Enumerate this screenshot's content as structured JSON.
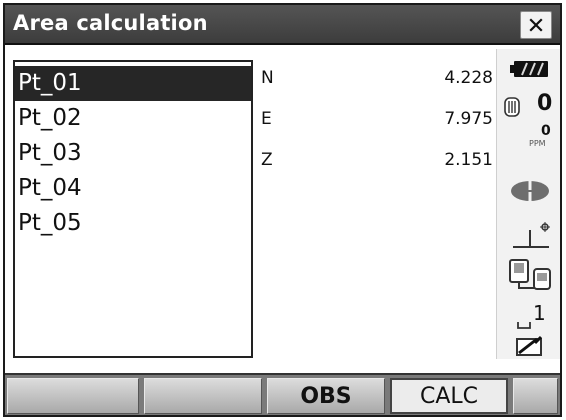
{
  "window": {
    "title": "Area calculation",
    "close_icon": "close-icon"
  },
  "points": [
    {
      "label": "Pt_01",
      "selected": true
    },
    {
      "label": "Pt_02",
      "selected": false
    },
    {
      "label": "Pt_03",
      "selected": false
    },
    {
      "label": "Pt_04",
      "selected": false
    },
    {
      "label": "Pt_05",
      "selected": false
    }
  ],
  "coordinates": [
    {
      "label": "N",
      "value": "4.228"
    },
    {
      "label": "E",
      "value": "7.975"
    },
    {
      "label": "Z",
      "value": "2.151"
    }
  ],
  "status": {
    "battery_icon": "battery-icon",
    "prism_icon": "prism-icon",
    "prism_constant": "0",
    "ppm_value": "0",
    "ppm_unit": "PPM",
    "laser_icon": "laser-icon",
    "tilt_icon": "tilt-icon",
    "communication_icon": "communication-icon",
    "input_mode": "1",
    "input_mode_icon": "input-mode-icon",
    "memory_card_icon": "memory-card-icon"
  },
  "softkeys": [
    "",
    "",
    "OBS",
    "CALC",
    ""
  ],
  "colors": {
    "titlebar": "#3c3c3c",
    "selection": "#262626",
    "softkey_bar": "#7a7a7a"
  }
}
